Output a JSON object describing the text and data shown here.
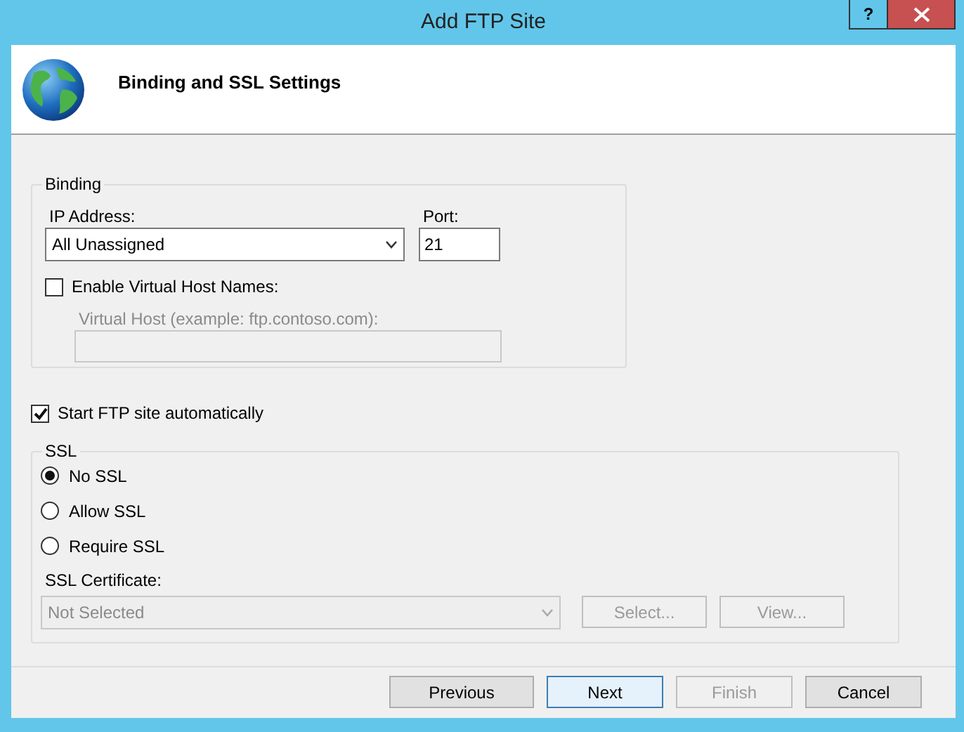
{
  "window": {
    "title": "Add FTP Site",
    "help_button": "?"
  },
  "header": {
    "title": "Binding and SSL Settings"
  },
  "binding": {
    "legend": "Binding",
    "ip_label": "IP Address:",
    "ip_value": "All Unassigned",
    "port_label": "Port:",
    "port_value": "21",
    "virtual_host": {
      "label": "Enable Virtual Host Names:",
      "checked": false
    },
    "virtual_host_field": {
      "label": "Virtual Host (example: ftp.contoso.com):",
      "disabled": true
    }
  },
  "start_automatically": {
    "label": "Start FTP site automatically",
    "checked": true
  },
  "ssl": {
    "legend": "SSL",
    "options": [
      {
        "label": "No SSL",
        "selected": true
      },
      {
        "label": "Allow SSL",
        "selected": false
      },
      {
        "label": "Require SSL",
        "selected": false
      }
    ],
    "certificate_label": "SSL Certificate:",
    "certificate_value": "Not Selected",
    "certificate_disabled": true,
    "buttons": [
      {
        "label": "Select...",
        "disabled": true
      },
      {
        "label": "View...",
        "disabled": true
      }
    ]
  },
  "footer_buttons": [
    {
      "label": "Previous",
      "disabled": false,
      "default": false
    },
    {
      "label": "Next",
      "disabled": false,
      "default": true
    },
    {
      "label": "Finish",
      "disabled": true,
      "default": false
    },
    {
      "label": "Cancel",
      "disabled": false,
      "default": false
    }
  ]
}
